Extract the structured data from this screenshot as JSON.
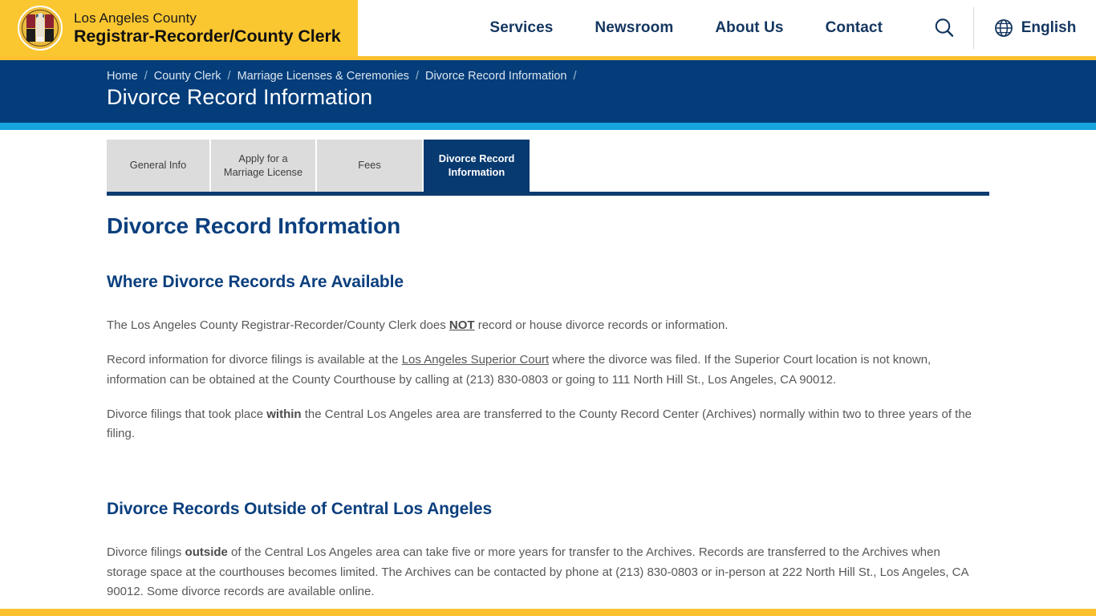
{
  "header": {
    "brand": {
      "line1": "Los Angeles County",
      "line2": "Registrar-Recorder/County Clerk",
      "seal_name": "la-county-seal"
    },
    "nav": [
      {
        "label": "Services"
      },
      {
        "label": "Newsroom"
      },
      {
        "label": "About Us"
      },
      {
        "label": "Contact"
      }
    ],
    "search_icon": "search-icon",
    "language": {
      "icon": "globe-icon",
      "label": "English"
    },
    "accent_yellow": "#fbc02d",
    "brand_yellow": "#fbc731"
  },
  "banner": {
    "breadcrumbs": [
      "Home",
      "County Clerk",
      "Marriage Licenses & Ceremonies",
      "Divorce Record Information"
    ],
    "separator": "/",
    "title": "Divorce Record Information",
    "bg_color": "#043d7a",
    "rule_color": "#16a4dd"
  },
  "tabs": {
    "items": [
      {
        "label": "General Info",
        "active": false
      },
      {
        "label": "Apply for a Marriage License",
        "active": false
      },
      {
        "label": "Fees",
        "active": false
      },
      {
        "label": "Divorce Record Information",
        "active": true
      }
    ],
    "active_color": "#073a70",
    "inactive_color": "#dcdcdc"
  },
  "main": {
    "page_title": "Divorce Record Information",
    "sections": [
      {
        "heading": "Where Divorce Records Are Available",
        "paragraphs": [
          {
            "parts": [
              {
                "type": "text",
                "text": "The Los Angeles County Registrar-Recorder/County Clerk does "
              },
              {
                "type": "strong-underline",
                "text": "NOT"
              },
              {
                "type": "text",
                "text": " record or house divorce records or information."
              }
            ]
          },
          {
            "parts": [
              {
                "type": "text",
                "text": "Record information for divorce filings is available at the "
              },
              {
                "type": "link",
                "text": "Los Angeles Superior Court"
              },
              {
                "type": "text",
                "text": " where the divorce was filed. If the Superior Court location is not known, information can be obtained at the County Courthouse by calling at (213) 830-0803 or going to 111 North Hill St., Los Angeles, CA 90012."
              }
            ]
          },
          {
            "parts": [
              {
                "type": "text",
                "text": "Divorce filings that took place "
              },
              {
                "type": "bold",
                "text": "within"
              },
              {
                "type": "text",
                "text": " the Central Los Angeles area are transferred to the County Record Center (Archives) normally within two to three years of the filing."
              }
            ]
          }
        ]
      },
      {
        "heading": "Divorce Records Outside of Central Los Angeles",
        "paragraphs": [
          {
            "parts": [
              {
                "type": "text",
                "text": "Divorce filings "
              },
              {
                "type": "bold",
                "text": "outside"
              },
              {
                "type": "text",
                "text": " of the Central Los Angeles area can take five or more years for transfer to the Archives. Records are transferred to the Archives when storage space at the courthouses becomes limited. The Archives can be contacted by phone at (213) 830-0803 or in-person at 222 North Hill St., Los Angeles, CA 90012. Some divorce records are available online."
              }
            ]
          }
        ]
      }
    ],
    "heading_color": "#0b3f7e",
    "body_color": "#58585a"
  },
  "footer": {
    "rule_color": "#fbc02d"
  }
}
